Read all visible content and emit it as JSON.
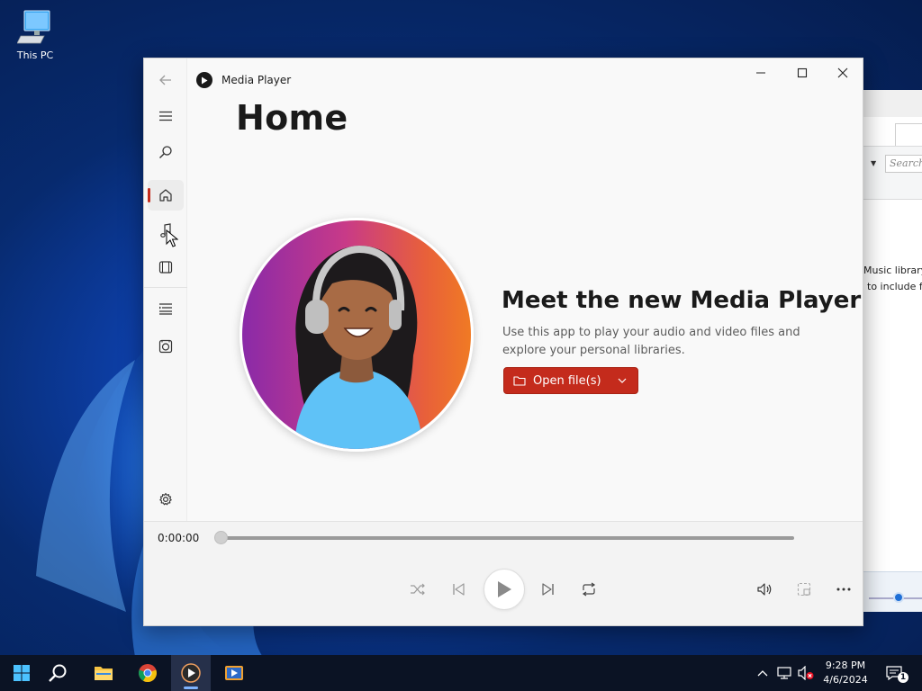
{
  "desktop": {
    "icons": [
      {
        "label": "This PC",
        "icon": "monitor-icon"
      }
    ]
  },
  "background_window": {
    "search_placeholder": "Search",
    "text_lines": [
      "Music library",
      "to include f"
    ]
  },
  "media_player": {
    "app_title": "Media Player",
    "page_title": "Home",
    "nav": [
      {
        "name": "back",
        "icon": "back-arrow-icon"
      },
      {
        "name": "menu",
        "icon": "hamburger-icon"
      },
      {
        "name": "search",
        "icon": "search-icon"
      },
      {
        "name": "home",
        "icon": "home-icon",
        "active": true
      },
      {
        "name": "music",
        "icon": "music-note-icon"
      },
      {
        "name": "video",
        "icon": "film-icon"
      },
      {
        "name": "play-queue",
        "icon": "queue-icon"
      },
      {
        "name": "playlists",
        "icon": "playlist-icon"
      },
      {
        "name": "settings",
        "icon": "gear-icon"
      }
    ],
    "headline": "Meet the new Media Player",
    "subtext": "Use this app to play your audio and video files and explore your personal libraries.",
    "open_button_label": "Open file(s)",
    "playback": {
      "time": "0:00:00",
      "progress": 0
    },
    "accent_color": "#c42b1c"
  },
  "taskbar": {
    "apps": [
      "windows-start",
      "search",
      "file-explorer",
      "chrome",
      "media-player",
      "windows-media-player"
    ],
    "clock_time": "9:28 PM",
    "clock_date": "4/6/2024",
    "notification_count": "1"
  }
}
